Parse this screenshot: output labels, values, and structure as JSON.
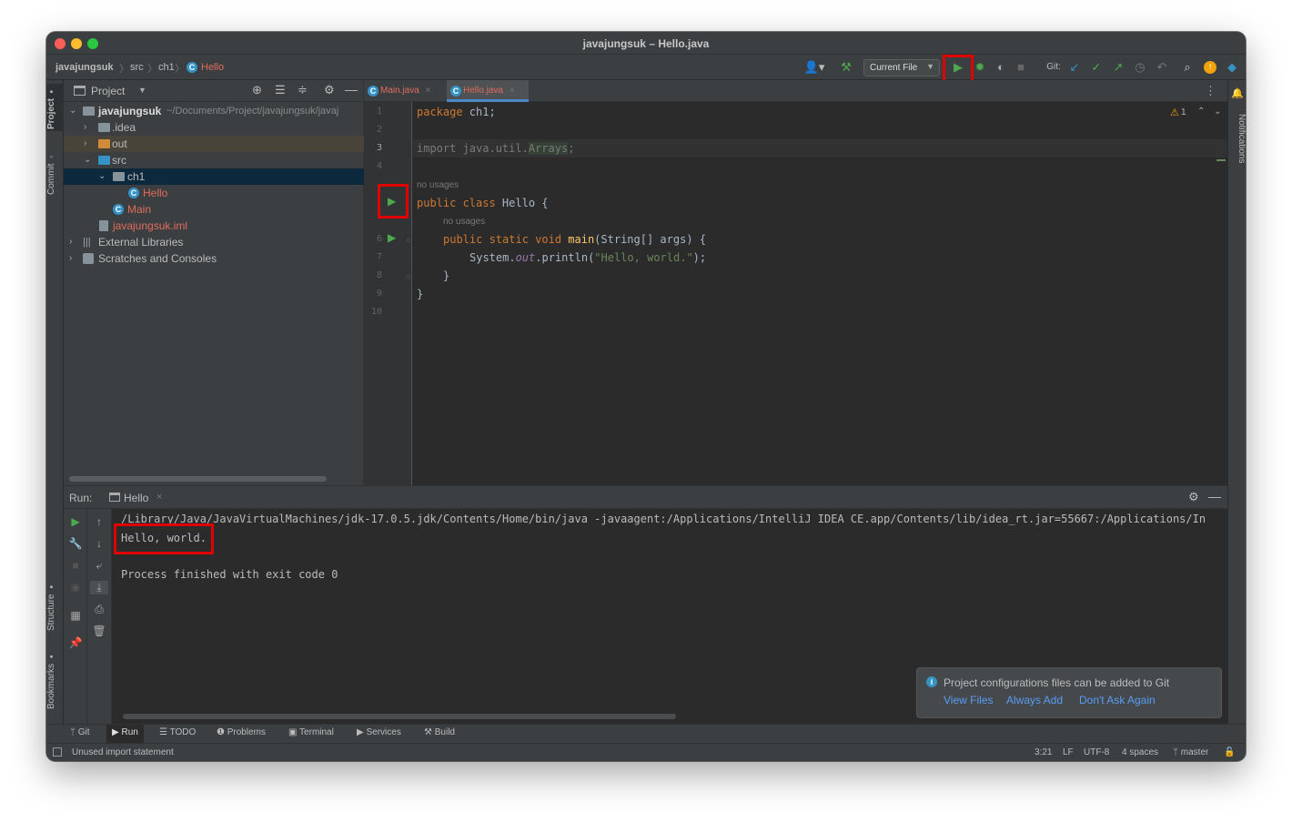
{
  "window": {
    "title": "javajungsuk – Hello.java"
  },
  "breadcrumbs": [
    "javajungsuk",
    "src",
    "ch1",
    "Hello"
  ],
  "toolbar": {
    "run_config": "Current File",
    "git_label": "Git:"
  },
  "left_strip": {
    "project": "Project",
    "commit": "Commit",
    "structure": "Structure",
    "bookmarks": "Bookmarks"
  },
  "right_strip": {
    "notifications": "Notifications"
  },
  "project_panel": {
    "title": "Project",
    "root_name": "javajungsuk",
    "root_path": "~/Documents/Project/javajungsuk/javaj",
    "items": {
      "idea": ".idea",
      "out": "out",
      "src": "src",
      "ch1": "ch1",
      "hello": "Hello",
      "main": "Main",
      "iml": "javajungsuk.iml",
      "ext_libs": "External Libraries",
      "scratches": "Scratches and Consoles"
    }
  },
  "editor": {
    "tabs": [
      "Main.java",
      "Hello.java"
    ],
    "active_tab": "Hello.java",
    "line_numbers": [
      "1",
      "2",
      "3",
      "4",
      "",
      "6",
      "7",
      "8",
      "9",
      "10"
    ],
    "no_usages_1": "no usages",
    "no_usages_2": "no usages",
    "warning_count": "1",
    "code": {
      "l1_kw": "package",
      "l1_rest": " ch1;",
      "l3_a": "import java.util.",
      "l3_b": "Arrays",
      "l3_c": ";",
      "l5_kw": "public class",
      "l5_rest": " Hello {",
      "l6_kw": "public static void",
      "l6_fn": " main",
      "l6_rest": "(String[] args) {",
      "l7_a": "System.",
      "l7_fld": "out",
      "l7_b": ".println(",
      "l7_str": "\"Hello, world.\"",
      "l7_c": ");",
      "l8": "}",
      "l9": "}"
    }
  },
  "run_panel": {
    "label": "Run:",
    "tab": "Hello",
    "console_lines": [
      "/Library/Java/JavaVirtualMachines/jdk-17.0.5.jdk/Contents/Home/bin/java -javaagent:/Applications/IntelliJ IDEA CE.app/Contents/lib/idea_rt.jar=55667:/Applications/In",
      "Hello, world.",
      "",
      "Process finished with exit code 0"
    ]
  },
  "notification": {
    "message": "Project configurations files can be added to Git",
    "actions": [
      "View Files",
      "Always Add",
      "Don't Ask Again"
    ]
  },
  "bottom_tabs": [
    "Git",
    "Run",
    "TODO",
    "Problems",
    "Terminal",
    "Services",
    "Build"
  ],
  "status_bar": {
    "message": "Unused import statement",
    "position": "3:21",
    "line_sep": "LF",
    "encoding": "UTF-8",
    "indent": "4 spaces",
    "branch": "master"
  },
  "colors": {
    "run_green": "#4ea94e",
    "highlight_red": "#e00000",
    "accent_blue": "#3592c4",
    "link_blue": "#589df6",
    "keyword": "#cc7832",
    "string": "#6a8759"
  }
}
